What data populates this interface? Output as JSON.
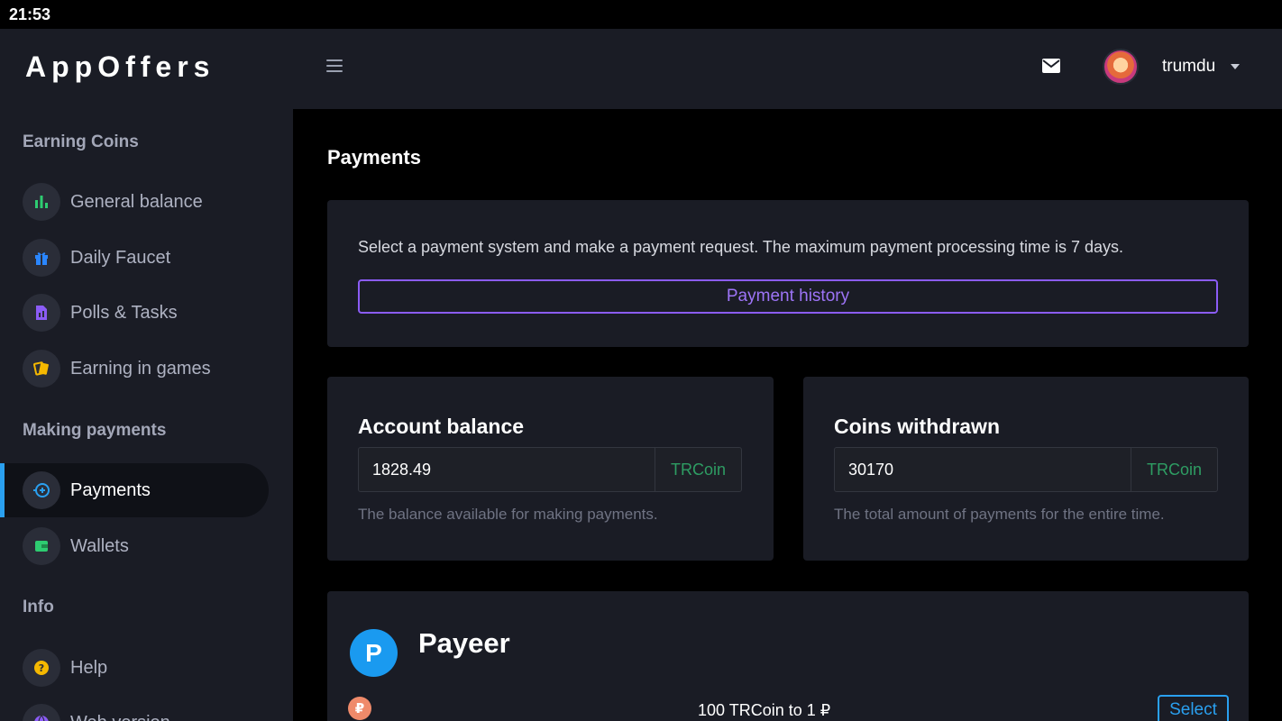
{
  "status_bar": {
    "time": "21:53"
  },
  "app": {
    "logo": "AppOffers"
  },
  "sidebar": {
    "sections": [
      {
        "title": "Earning Coins",
        "items": [
          {
            "label": "General balance",
            "icon": "bar-chart-icon"
          },
          {
            "label": "Daily Faucet",
            "icon": "gift-icon"
          },
          {
            "label": "Polls & Tasks",
            "icon": "document-icon"
          },
          {
            "label": "Earning in games",
            "icon": "playing-cards-icon"
          }
        ]
      },
      {
        "title": "Making payments",
        "items": [
          {
            "label": "Payments",
            "icon": "coin-arrow-icon",
            "active": true
          },
          {
            "label": "Wallets",
            "icon": "wallet-icon"
          }
        ]
      },
      {
        "title": "Info",
        "items": [
          {
            "label": "Help",
            "icon": "help-icon"
          },
          {
            "label": "Web version",
            "icon": "globe-icon"
          }
        ]
      }
    ]
  },
  "header": {
    "username": "trumdu",
    "menu_icon": "hamburger-icon",
    "mail_icon": "mail-icon"
  },
  "page": {
    "title": "Payments",
    "info_text": "Select a payment system and make a payment request. The maximum payment processing time is 7 days.",
    "history_button": "Payment history"
  },
  "balance_card": {
    "title": "Account balance",
    "value": "1828.49",
    "unit": "TRCoin",
    "help": "The balance available for making payments."
  },
  "withdrawn_card": {
    "title": "Coins withdrawn",
    "value": "30170",
    "unit": "TRCoin",
    "help": "The total amount of payments for the entire time."
  },
  "payment_system": {
    "logo_letter": "P",
    "name": "Payeer",
    "currency_symbol": "₽",
    "rate": "100 TRCoin to 1 ₽",
    "select_button": "Select"
  },
  "colors": {
    "accent_purple": "#8b5cf6",
    "accent_blue": "#2aa0f0",
    "coin_green": "#2e9d63",
    "panel_bg": "#1a1c25",
    "page_bg": "#000000"
  }
}
